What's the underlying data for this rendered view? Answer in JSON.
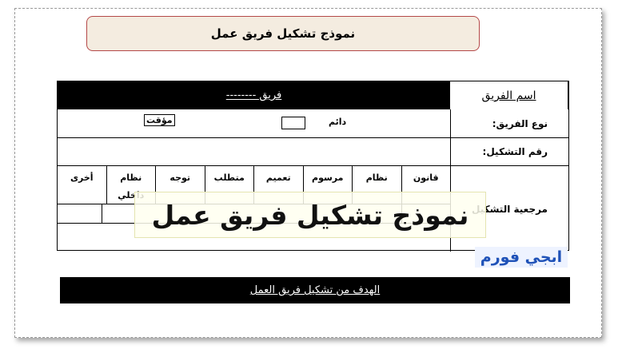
{
  "title": "نموذج تشكيل فريق عمل",
  "team_name": {
    "label": "اسم الفريق",
    "value": "فريق --------"
  },
  "team_type": {
    "label": "نوع الفريق:",
    "option1": "دائم",
    "option2": "مؤقت"
  },
  "formation_number": {
    "label": "رقم التشكيل:"
  },
  "reference": {
    "label": "مرجعية التشكيل",
    "columns": [
      "قانون",
      "نظام",
      "مرسوم",
      "تعميم",
      "متطلب",
      "توجه",
      "نظام داخلي",
      "أخرى"
    ]
  },
  "watermark": "نموذج تشكيل فريق عمل",
  "logo": "ابجي فورم",
  "goal_bar": "الهدف من تشكيل فريق العمل"
}
